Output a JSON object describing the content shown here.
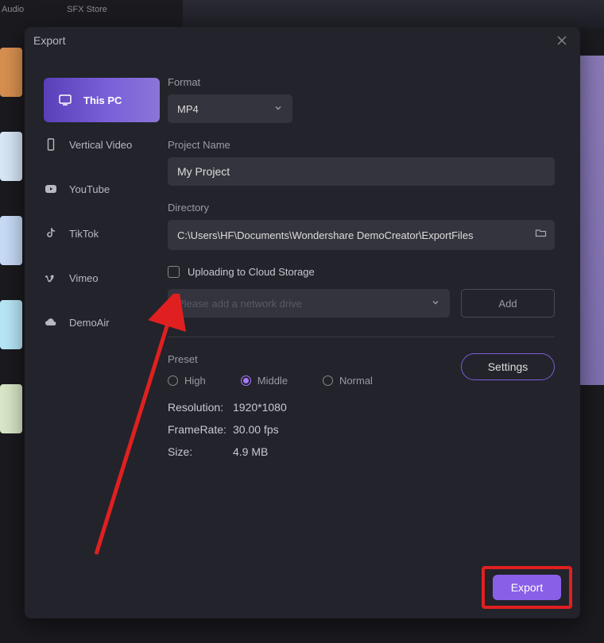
{
  "topTabs": {
    "audio": "Audio",
    "sfx": "SFX Store"
  },
  "dialog": {
    "title": "Export",
    "sidebar": [
      {
        "label": "This PC",
        "icon": "pc",
        "active": true
      },
      {
        "label": "Vertical Video",
        "icon": "phone"
      },
      {
        "label": "YouTube",
        "icon": "youtube"
      },
      {
        "label": "TikTok",
        "icon": "tiktok"
      },
      {
        "label": "Vimeo",
        "icon": "vimeo"
      },
      {
        "label": "DemoAir",
        "icon": "cloud"
      }
    ],
    "format": {
      "label": "Format",
      "value": "MP4"
    },
    "project": {
      "label": "Project Name",
      "value": "My Project"
    },
    "directory": {
      "label": "Directory",
      "value": "C:\\Users\\HF\\Documents\\Wondershare DemoCreator\\ExportFiles"
    },
    "uploadCheck": "Uploading to Cloud Storage",
    "cloudPlaceholder": "Please add a network drive",
    "addBtn": "Add",
    "preset": {
      "label": "Preset",
      "settings": "Settings",
      "options": [
        "High",
        "Middle",
        "Normal"
      ],
      "selected": 1
    },
    "info": {
      "resolution": {
        "k": "Resolution:",
        "v": "1920*1080"
      },
      "framerate": {
        "k": "FrameRate:",
        "v": "30.00 fps"
      },
      "size": {
        "k": "Size:",
        "v": "4.9 MB"
      }
    },
    "exportBtn": "Export"
  }
}
